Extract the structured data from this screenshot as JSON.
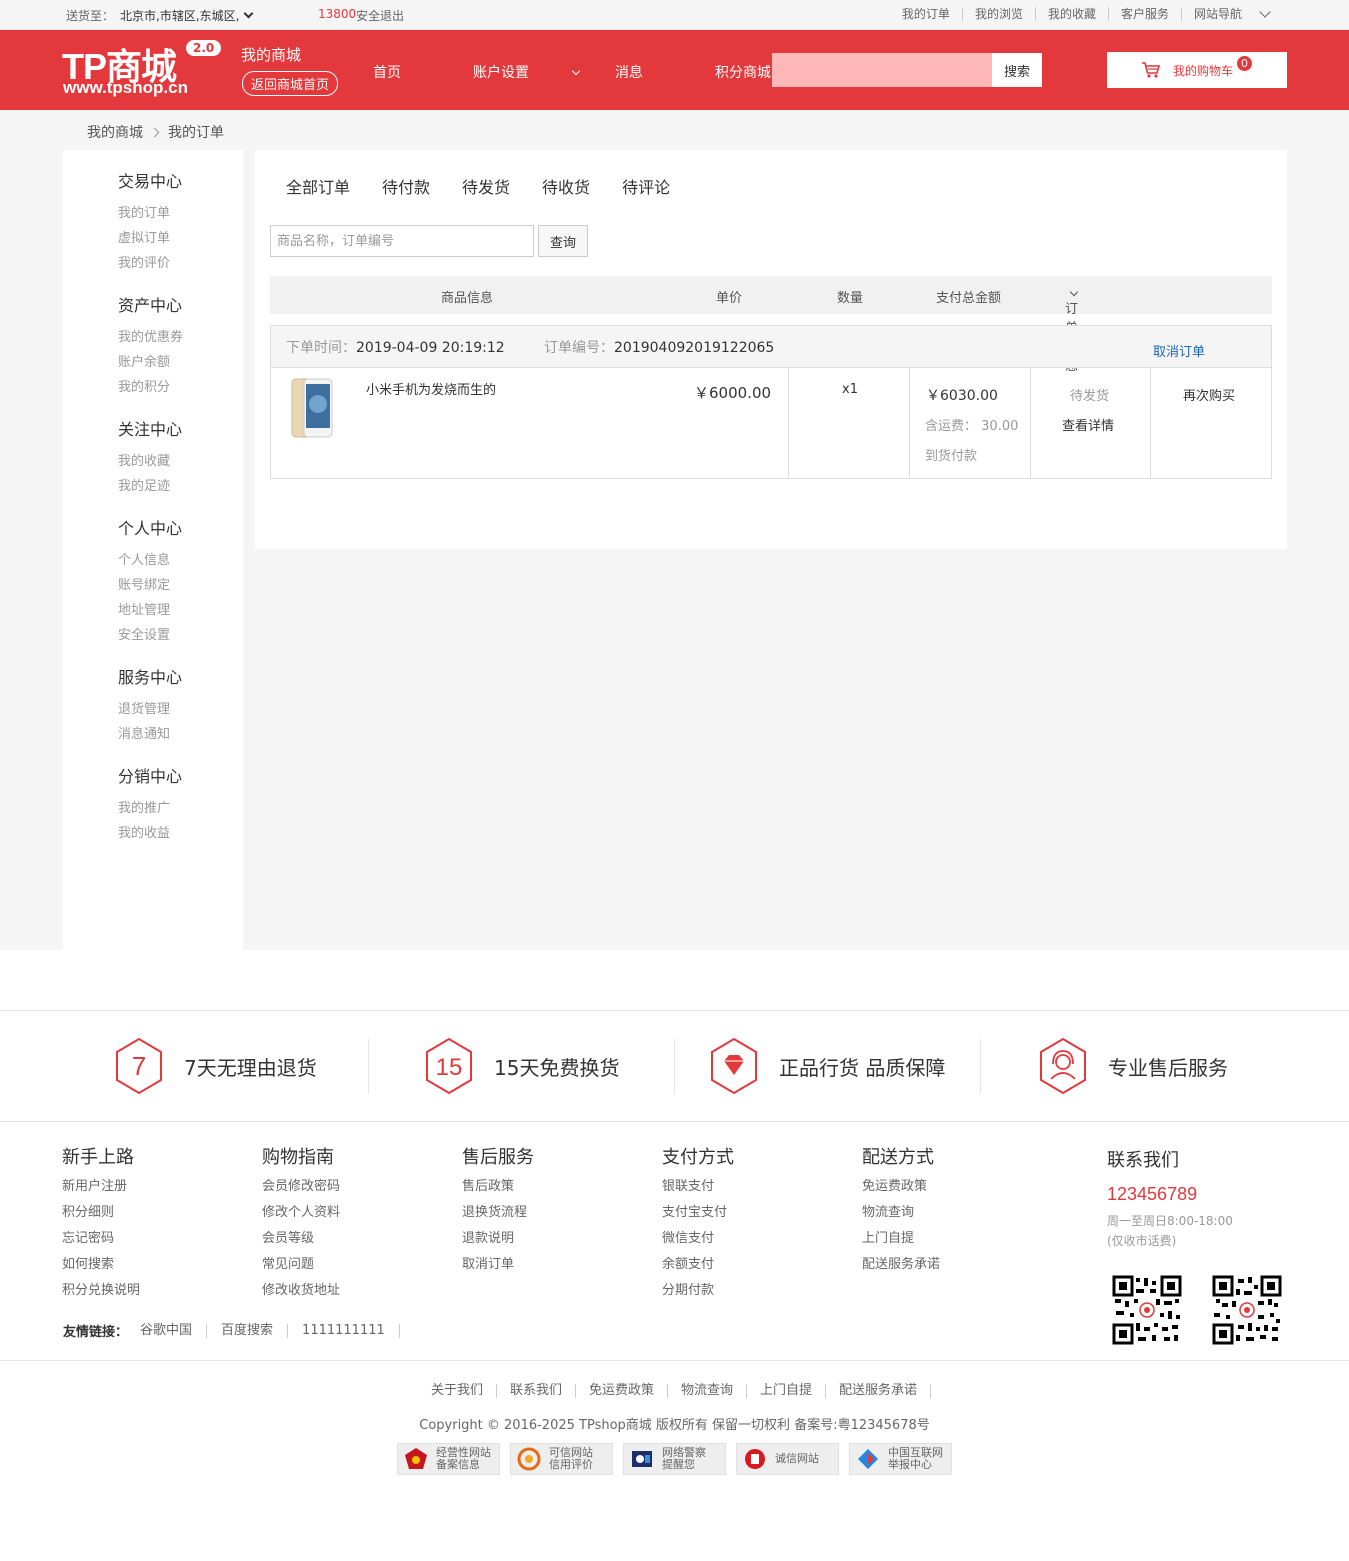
{
  "topbar": {
    "deliver_label": "送货至：",
    "address": "北京市,市辖区,东城区,",
    "phone": "13800",
    "logout": "安全退出",
    "links": [
      "我的订单",
      "我的浏览",
      "我的收藏",
      "客户服务",
      "网站导航"
    ]
  },
  "header": {
    "logo_text": "TP商城",
    "logo_version": "2.0",
    "logo_url": "www.tpshop.cn",
    "my_mall": "我的商城",
    "back_home": "返回商城首页",
    "nav": [
      "首页",
      "账户设置",
      "消息",
      "积分商城"
    ],
    "search_placeholder": "",
    "search_button": "搜索",
    "cart_label": "我的购物车",
    "cart_count": "0"
  },
  "breadcrumb": [
    "我的商城",
    "我的订单"
  ],
  "sidebar": [
    {
      "title": "交易中心",
      "items": [
        "我的订单",
        "虚拟订单",
        "我的评价"
      ]
    },
    {
      "title": "资产中心",
      "items": [
        "我的优惠券",
        "账户余额",
        "我的积分"
      ]
    },
    {
      "title": "关注中心",
      "items": [
        "我的收藏",
        "我的足迹"
      ]
    },
    {
      "title": "个人中心",
      "items": [
        "个人信息",
        "账号绑定",
        "地址管理",
        "安全设置"
      ]
    },
    {
      "title": "服务中心",
      "items": [
        "退货管理",
        "消息通知"
      ]
    },
    {
      "title": "分销中心",
      "items": [
        "我的推广",
        "我的收益"
      ]
    }
  ],
  "orders": {
    "tabs": [
      "全部订单",
      "待付款",
      "待发货",
      "待收货",
      "待评论"
    ],
    "search_placeholder": "商品名称，订单编号",
    "query_button": "查询",
    "columns": [
      "商品信息",
      "单价",
      "数量",
      "支付总金额",
      "订单状态"
    ],
    "order": {
      "time_label": "下单时间：",
      "time": "2019-04-09 20:19:12",
      "sn_label": "订单编号：",
      "sn": "201904092019122065",
      "cancel": "取消订单",
      "product_name": "小米手机为发烧而生的",
      "unit_price": "￥6000.00",
      "quantity": "x1",
      "total": "￥6030.00",
      "shipping_label": "含运费：",
      "shipping": "30.00",
      "pay_type": "到货付款",
      "status": "待发货",
      "detail": "查看详情",
      "rebuy": "再次购买"
    }
  },
  "guarantee": [
    {
      "icon_text": "7",
      "text": "7天无理由退货"
    },
    {
      "icon_text": "15",
      "text": "15天免费换货"
    },
    {
      "icon_text": "",
      "text": "正品行货 品质保障"
    },
    {
      "icon_text": "",
      "text": "专业售后服务"
    }
  ],
  "footer": {
    "columns": [
      {
        "title": "新手上路",
        "items": [
          "新用户注册",
          "积分细则",
          "忘记密码",
          "如何搜索",
          "积分兑换说明"
        ]
      },
      {
        "title": "购物指南",
        "items": [
          "会员修改密码",
          "修改个人资料",
          "会员等级",
          "常见问题",
          "修改收货地址"
        ]
      },
      {
        "title": "售后服务",
        "items": [
          "售后政策",
          "退换货流程",
          "退款说明",
          "取消订单"
        ]
      },
      {
        "title": "支付方式",
        "items": [
          "银联支付",
          "支付宝支付",
          "微信支付",
          "余额支付",
          "分期付款"
        ]
      },
      {
        "title": "配送方式",
        "items": [
          "免运费政策",
          "物流查询",
          "上门自提",
          "配送服务承诺"
        ]
      }
    ],
    "contact_title": "联系我们",
    "contact_phone": "123456789",
    "contact_hours": "周一至周日8:00-18:00",
    "contact_note": "(仅收市话费)",
    "friends_label": "友情链接：",
    "friends": [
      "谷歌中国",
      "百度搜索",
      "1111111111"
    ],
    "bottom_links": [
      "关于我们",
      "联系我们",
      "免运费政策",
      "物流查询",
      "上门自提",
      "配送服务承诺"
    ],
    "copyright": "Copyright © 2016-2025 TPshop商城 版权所有 保留一切权利 备案号:粤12345678号",
    "badges": [
      {
        "line1": "经营性网站",
        "line2": "备案信息"
      },
      {
        "line1": "可信网站",
        "line2": "信用评价"
      },
      {
        "line1": "网络警察",
        "line2": "提醒您"
      },
      {
        "line1": "诚信网站",
        "line2": ""
      },
      {
        "line1": "中国互联网",
        "line2": "举报中心"
      }
    ]
  }
}
